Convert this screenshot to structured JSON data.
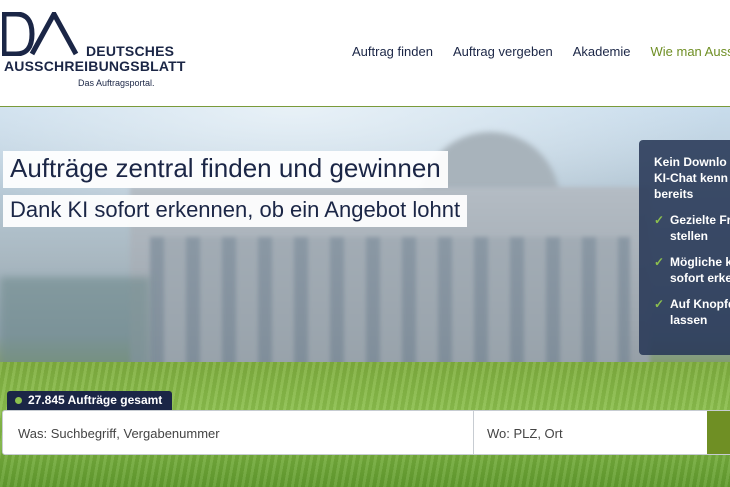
{
  "logo": {
    "line1": "DEUTSCHES",
    "line2": "AUSSCHREIBUNGSBLATT",
    "tagline": "Das Auftragsportal."
  },
  "nav": {
    "items": [
      {
        "label": "Auftrag finden"
      },
      {
        "label": "Auftrag vergeben"
      },
      {
        "label": "Akademie"
      },
      {
        "label": "Wie man Ausschr"
      }
    ],
    "accent_color": "#6f8f24"
  },
  "hero": {
    "headline": "Aufträge zentral finden und gewinnen",
    "subline": "Dank KI sofort erkennen, ob ein Angebot lohnt"
  },
  "promo": {
    "title_lines": [
      "Kein Downlo",
      "KI-Chat kenn",
      "bereits"
    ],
    "items": [
      {
        "lines": [
          "Gezielte Fra",
          "stellen"
        ]
      },
      {
        "lines": [
          "Mögliche k",
          "sofort erke"
        ]
      },
      {
        "lines": [
          "Auf Knopfd",
          "lassen"
        ]
      }
    ],
    "check_icon": "check-icon"
  },
  "search": {
    "count_label": "27.845 Aufträge gesamt",
    "what_placeholder": "Was: Suchbegriff, Vergabenummer",
    "where_placeholder": "Wo: PLZ, Ort"
  }
}
